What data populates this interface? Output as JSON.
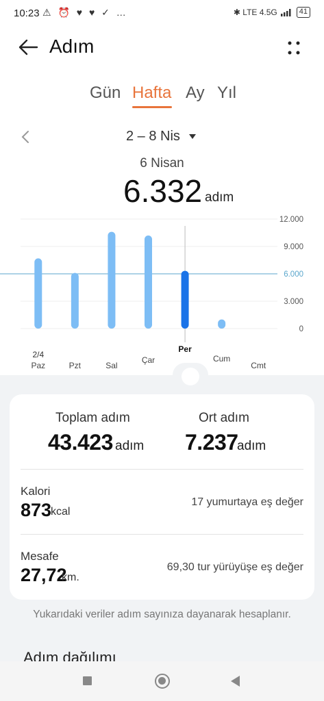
{
  "status": {
    "time": "10:23",
    "icons": "⚠ ⏰ ♥ ♥ ✓ …",
    "right_icons": "✱ LTE 4.5G",
    "battery": "41"
  },
  "header": {
    "title": "Adım"
  },
  "tabs": [
    {
      "label": "Gün",
      "active": false
    },
    {
      "label": "Hafta",
      "active": true
    },
    {
      "label": "Ay",
      "active": false
    },
    {
      "label": "Yıl",
      "active": false
    }
  ],
  "range": {
    "label": "2 – 8 Nis"
  },
  "selected": {
    "date": "6 Nisan",
    "value": "6.332",
    "unit": "adım"
  },
  "chart_data": {
    "type": "bar",
    "categories": [
      "Paz",
      "Pzt",
      "Sal",
      "Çar",
      "Per",
      "Cum",
      "Cmt"
    ],
    "category_prefix": {
      "Paz": "2/4"
    },
    "values": [
      7700,
      6100,
      10600,
      10200,
      6332,
      1000,
      0
    ],
    "ylim": [
      0,
      12000
    ],
    "yticks": [
      "12.000",
      "9.000",
      "6.000",
      "3.000",
      "0"
    ],
    "ytick_values": [
      12000,
      9000,
      6000,
      3000,
      0
    ],
    "goal_line": 6000,
    "selected_index": 4,
    "colors": {
      "bar": "#7dbdf5",
      "selected": "#1a73e8",
      "goal": "#5aa6cc"
    }
  },
  "summary": {
    "total_label": "Toplam adım",
    "total_value": "43.423",
    "total_unit": "adım",
    "avg_label": "Ort adım",
    "avg_value": "7.237",
    "avg_unit": "adım",
    "calories_label": "Kalori",
    "calories_value": "873",
    "calories_unit": "kcal",
    "calories_equiv": "17 yumurtaya eş değer",
    "distance_label": "Mesafe",
    "distance_value": "27,72",
    "distance_unit": "km.",
    "distance_equiv": "69,30 tur yürüyüşe eş değer"
  },
  "note": "Yukarıdaki veriler adım sayınıza dayanarak hesaplanır.",
  "next_section": "Adım dağılımı"
}
